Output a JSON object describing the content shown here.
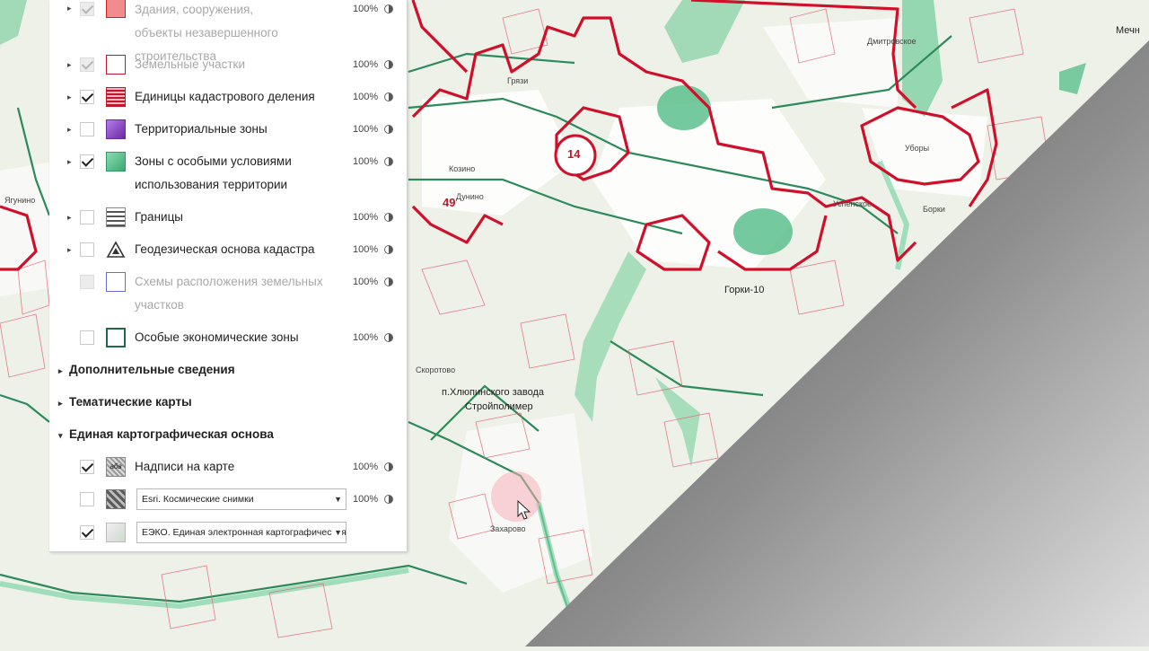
{
  "layers_panel": {
    "items": [
      {
        "id": "buildings",
        "label_line1": "Здания, сооружения,",
        "label_line2": "объекты незавершенного строительства",
        "percent": "100%",
        "checked": true,
        "disabled": true,
        "has_expander": true,
        "swatch_color": "#f28b8b",
        "swatch_border": "#d02020"
      },
      {
        "id": "land",
        "label_line1": "Земельные участки",
        "label_line2": "",
        "percent": "100%",
        "checked": true,
        "disabled": true,
        "has_expander": true,
        "swatch_color": "#ffffff",
        "swatch_border": "#c0182a"
      },
      {
        "id": "cadastral",
        "label_line1": "Единицы кадастрового деления",
        "label_line2": "",
        "percent": "100%",
        "checked": true,
        "disabled": false,
        "has_expander": true,
        "swatch_color": "#c0182a",
        "swatch_border": "#c0182a"
      },
      {
        "id": "zones",
        "label_line1": "Территориальные зоны",
        "label_line2": "",
        "percent": "100%",
        "checked": false,
        "disabled": false,
        "has_expander": true,
        "swatch_color": "#8a3fc7",
        "swatch_border": "#6a2aa6"
      },
      {
        "id": "special",
        "label_line1": "Зоны с особыми условиями",
        "label_line2": "использования территории",
        "percent": "100%",
        "checked": true,
        "disabled": false,
        "has_expander": true,
        "swatch_color": "#5cc08d",
        "swatch_border": "#2f9a66"
      },
      {
        "id": "borders",
        "label_line1": "Границы",
        "label_line2": "",
        "percent": "100%",
        "checked": false,
        "disabled": false,
        "has_expander": true,
        "swatch_color": "#555555",
        "swatch_border": "#555555"
      },
      {
        "id": "geodesic",
        "label_line1": "Геодезическая основа кадастра",
        "label_line2": "",
        "percent": "100%",
        "checked": false,
        "disabled": false,
        "has_expander": true,
        "swatch_color": "#444444",
        "swatch_border": "#444444"
      },
      {
        "id": "schemes",
        "label_line1": "Схемы расположения земельных",
        "label_line2": "участков",
        "percent": "100%",
        "checked": false,
        "disabled": true,
        "has_expander": false,
        "swatch_color": "#ffffff",
        "swatch_border": "#6a6ad8"
      },
      {
        "id": "econ",
        "label_line1": "Особые экономические зоны",
        "label_line2": "",
        "percent": "100%",
        "checked": false,
        "disabled": false,
        "has_expander": false,
        "swatch_color": "#ffffff",
        "swatch_border": "#1f6b45"
      }
    ],
    "sections": {
      "additional": "Дополнительные сведения",
      "thematic": "Тематические карты",
      "basemap": "Единая картографическая основа"
    },
    "basemap_items": {
      "labels": {
        "label": "Надписи на карте",
        "percent": "100%",
        "checked": true
      },
      "esri": {
        "select_value": "Esri. Космические снимки",
        "percent": "100%",
        "checked": false
      },
      "eeko": {
        "select_value": "ЕЭКО. Единая электронная картографическая основа",
        "checked": true
      }
    }
  },
  "map": {
    "labels": {
      "dmitrovskoe": "Дмитровское",
      "mechn": "Мечн",
      "uborы": "Уборы",
      "borki": "Борки",
      "uspenskoe": "Успенское",
      "gorki10": "Горки-10",
      "kozino": "Козино",
      "gryazi": "Грязи",
      "dunino": "Дунино",
      "skorotovo": "Скоротово",
      "khlyupino": "п.Хлюпинского завода",
      "stroypolimer": "Стройполимер",
      "zakharovo": "Захарово",
      "yagunino": "Ягунино",
      "num14": "14",
      "num49": "49"
    },
    "colors": {
      "base": "#eef1e8",
      "cadastral_red": "#d0102a",
      "zone_green": "#5fc58f",
      "road": "#2c8a5a",
      "wedge_dark": "#555555",
      "wedge_light": "#dcdcdc"
    }
  }
}
